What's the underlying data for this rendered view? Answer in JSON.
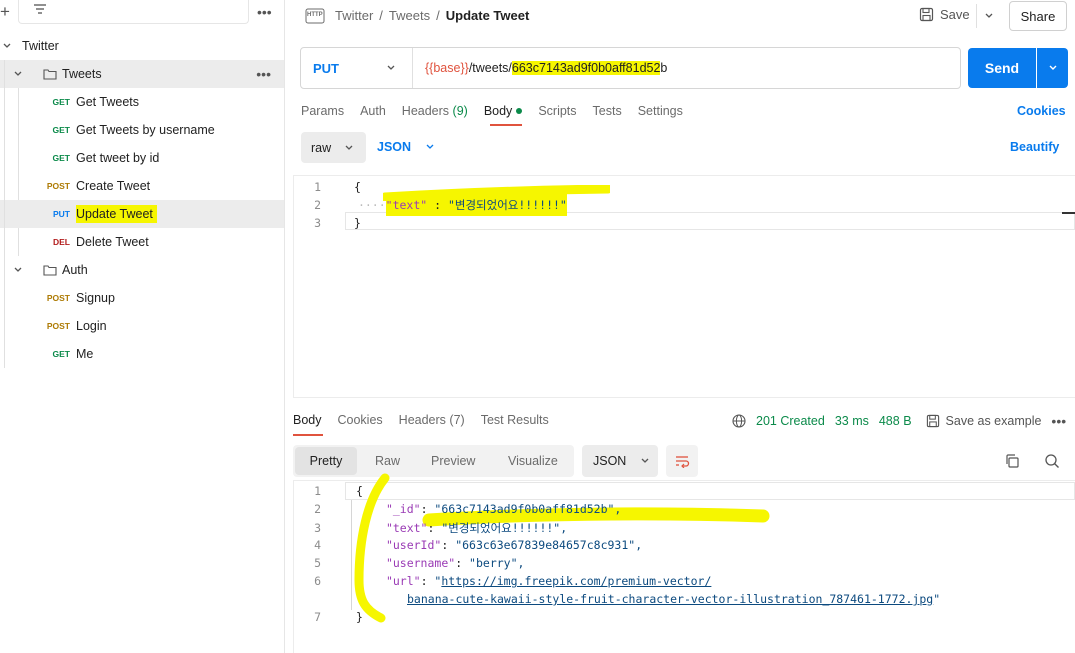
{
  "sidebar": {
    "collection": "Twitter",
    "folders": [
      {
        "name": "Tweets",
        "items": [
          {
            "method": "GET",
            "label": "Get Tweets"
          },
          {
            "method": "GET",
            "label": "Get Tweets by username"
          },
          {
            "method": "GET",
            "label": "Get tweet by id"
          },
          {
            "method": "POST",
            "label": "Create Tweet"
          },
          {
            "method": "PUT",
            "label": "Update Tweet"
          },
          {
            "method": "DEL",
            "label": "Delete Tweet"
          }
        ]
      },
      {
        "name": "Auth",
        "items": [
          {
            "method": "POST",
            "label": "Signup"
          },
          {
            "method": "POST",
            "label": "Login"
          },
          {
            "method": "GET",
            "label": "Me"
          }
        ]
      }
    ],
    "more": "•••"
  },
  "header": {
    "http_icon": "HTTP",
    "breadcrumb": [
      "Twitter",
      "Tweets"
    ],
    "sep": "/",
    "title": "Update Tweet",
    "save": "Save",
    "share": "Share"
  },
  "request": {
    "method": "PUT",
    "url_base": "{{base}}",
    "url_path": "/tweets/",
    "url_id": "663c7143ad9f0b0aff81d52",
    "url_tail": "b",
    "send": "Send",
    "tabs": [
      "Params",
      "Auth",
      "Headers",
      "Body",
      "Scripts",
      "Tests",
      "Settings"
    ],
    "headers_count": "(9)",
    "active_tab": "Body",
    "cookies": "Cookies",
    "body_mode": "raw",
    "body_format": "JSON",
    "beautify": "Beautify",
    "body_lines": [
      {
        "n": "1",
        "text": "{"
      },
      {
        "n": "2",
        "key": "\"text\"",
        "colon": " : ",
        "value": "\"변경되었어요!!!!!!\""
      },
      {
        "n": "3",
        "text": "}"
      }
    ]
  },
  "response": {
    "tabs": [
      "Body",
      "Cookies",
      "Headers",
      "Test Results"
    ],
    "headers_count": "(7)",
    "status": "201 Created",
    "time": "33 ms",
    "size": "488 B",
    "save_example": "Save as example",
    "views": [
      "Pretty",
      "Raw",
      "Preview",
      "Visualize"
    ],
    "format": "JSON",
    "lines": [
      {
        "n": "1",
        "text": "{"
      },
      {
        "n": "2",
        "key": "\"_id\"",
        "value": "\"663c7143ad9f0b0aff81d52b\","
      },
      {
        "n": "3",
        "key": "\"text\"",
        "value": "\"변경되었어요!!!!!!\","
      },
      {
        "n": "4",
        "key": "\"userId\"",
        "value": "\"663c63e67839e84657c8c931\","
      },
      {
        "n": "5",
        "key": "\"username\"",
        "value": "\"berry\","
      },
      {
        "n": "6",
        "key": "\"url\"",
        "value": "https://img.freepik.com/premium-vector/",
        "cont": "banana-cute-kawaii-style-fruit-character-vector-illustration_787461-1772.jpg"
      },
      {
        "n": "7",
        "text": "}"
      }
    ]
  },
  "colors": {
    "accent": "#097bed",
    "highlight": "#f6f600",
    "status_ok": "#0b8a4a"
  }
}
